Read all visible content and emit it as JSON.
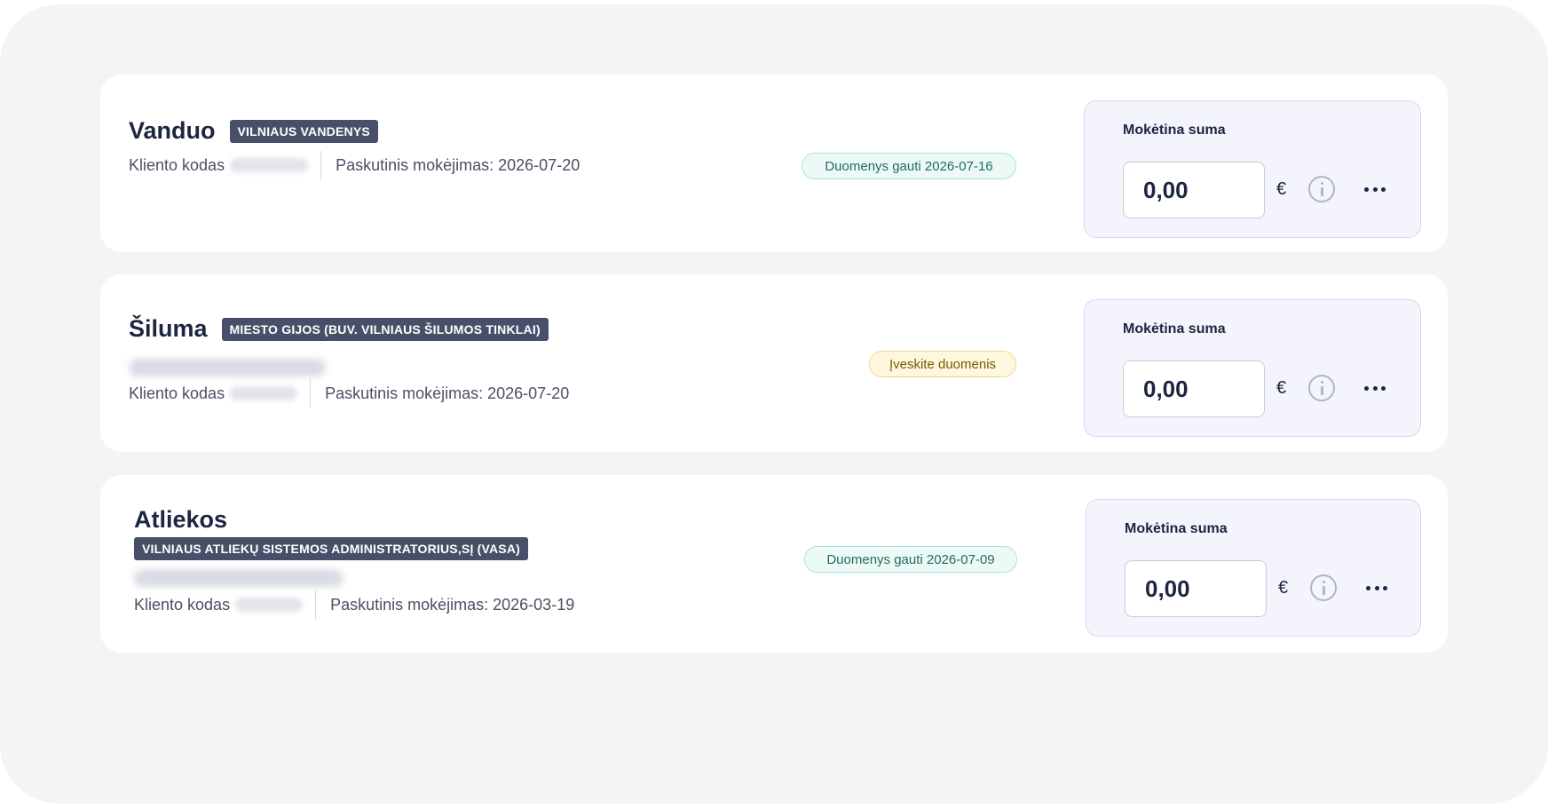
{
  "currency_symbol": "€",
  "pay_label": "Mokėtina suma",
  "client_code_label": "Kliento kodas",
  "utilities": [
    {
      "title": "Vanduo",
      "company": "VILNIAUS VANDENYS",
      "last_payment": "Paskutinis mokėjimas: 2026-07-20",
      "status": "Duomenys gauti 2026-07-16",
      "status_type": "received",
      "amount": "0,00",
      "address_blurred": false
    },
    {
      "title": "Šiluma",
      "company": "MIESTO GIJOS (BUV. VILNIAUS ŠILUMOS TINKLAI)",
      "last_payment": "Paskutinis mokėjimas: 2026-07-20",
      "status": "Įveskite duomenis",
      "status_type": "input-needed",
      "amount": "0,00",
      "address_blurred": true
    },
    {
      "title": "Atliekos",
      "company": "VILNIAUS ATLIEKŲ SISTEMOS ADMINISTRATORIUS,SĮ (VASA)",
      "last_payment": "Paskutinis mokėjimas: 2026-03-19",
      "status": "Duomenys gauti 2026-07-09",
      "status_type": "received",
      "amount": "0,00",
      "address_blurred": true
    }
  ],
  "colors": {
    "background": "#f3f4f6",
    "card": "#ffffff",
    "company_badge": "#485069",
    "status_received_bg": "#edf9f6",
    "status_received_border": "#a9e6d7",
    "status_input_bg": "#fdf7dd",
    "status_input_border": "#f0d98b",
    "payment_panel_bg": "#f4f4fd"
  }
}
